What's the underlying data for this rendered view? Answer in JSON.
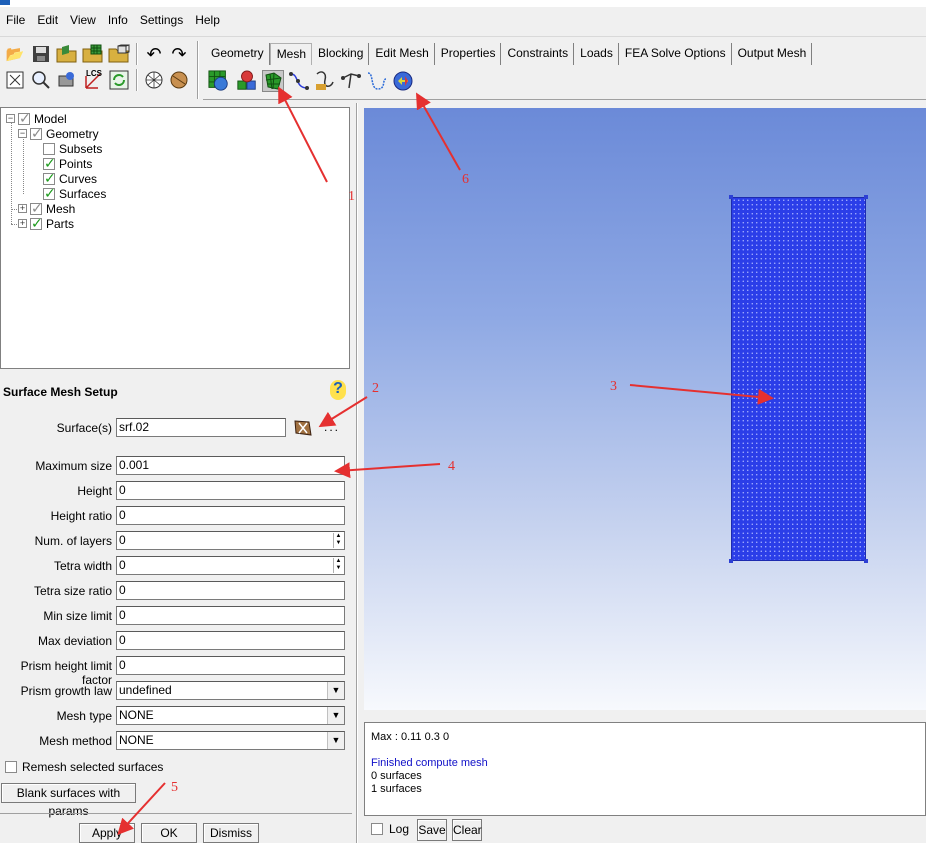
{
  "menu": [
    "File",
    "Edit",
    "View",
    "Info",
    "Settings",
    "Help"
  ],
  "tabs": [
    {
      "label": "Geometry"
    },
    {
      "label": "Mesh",
      "active": true
    },
    {
      "label": "Blocking"
    },
    {
      "label": "Edit Mesh"
    },
    {
      "label": "Properties"
    },
    {
      "label": "Constraints"
    },
    {
      "label": "Loads"
    },
    {
      "label": "FEA Solve Options"
    },
    {
      "label": "Output Mesh"
    }
  ],
  "toolbar_icons": {
    "row1": [
      "open-folder-icon",
      "save-icon",
      "open-geometry-icon",
      "open-mesh-icon",
      "open-blocking-icon",
      "undo-icon",
      "redo-icon"
    ],
    "row2": [
      "fit-window-icon",
      "zoom-box-icon",
      "measure-icon",
      "lcs-icon",
      "refresh-icon",
      "wireframe-icon",
      "solid-icon"
    ],
    "mesh_tab": [
      "global-mesh-setup-icon",
      "part-mesh-setup-icon",
      "surface-mesh-setup-icon",
      "curve-mesh-setup-icon",
      "create-mesh-density-icon",
      "connectors-icon",
      "mesh-curve-icon",
      "compute-mesh-icon"
    ],
    "lcs_label": "LCS"
  },
  "tree": {
    "model": "Model",
    "geometry": "Geometry",
    "subsets": "Subsets",
    "points": "Points",
    "curves": "Curves",
    "surfaces": "Surfaces",
    "mesh": "Mesh",
    "parts": "Parts"
  },
  "setup": {
    "title": "Surface Mesh Setup",
    "help_glyph": "?",
    "surfaces_label": "Surface(s)",
    "surfaces_value": "srf.02",
    "ellipsis": "...",
    "fields": [
      {
        "label": "Maximum size",
        "value": "0.001"
      },
      {
        "label": "Height",
        "value": "0"
      },
      {
        "label": "Height ratio",
        "value": "0"
      },
      {
        "label": "Num. of layers",
        "value": "0"
      },
      {
        "label": "Tetra width",
        "value": "0"
      },
      {
        "label": "Tetra size ratio",
        "value": "0"
      },
      {
        "label": "Min size limit",
        "value": "0"
      },
      {
        "label": "Max deviation",
        "value": "0"
      },
      {
        "label": "Prism height limit factor",
        "value": "0"
      }
    ],
    "prism_growth_label": "Prism growth law",
    "prism_growth_value": "undefined",
    "mesh_type_label": "Mesh type",
    "mesh_type_value": "NONE",
    "mesh_method_label": "Mesh method",
    "mesh_method_value": "NONE",
    "remesh_label": "Remesh selected surfaces",
    "blank_button": "Blank surfaces with params",
    "apply": "Apply",
    "ok": "OK",
    "dismiss": "Dismiss"
  },
  "console": {
    "line1": "Max : 0.11 0.3 0",
    "line2": "Finished compute mesh",
    "line3": "0 surfaces",
    "line4": "1 surfaces",
    "log_label": "Log",
    "save": "Save",
    "clear": "Clear"
  },
  "annotations": [
    "1",
    "2",
    "3",
    "4",
    "5",
    "6"
  ],
  "colors": {
    "annotation": "#e53030",
    "mesh": "#2b3ee8",
    "console_highlight": "#1010c8"
  }
}
